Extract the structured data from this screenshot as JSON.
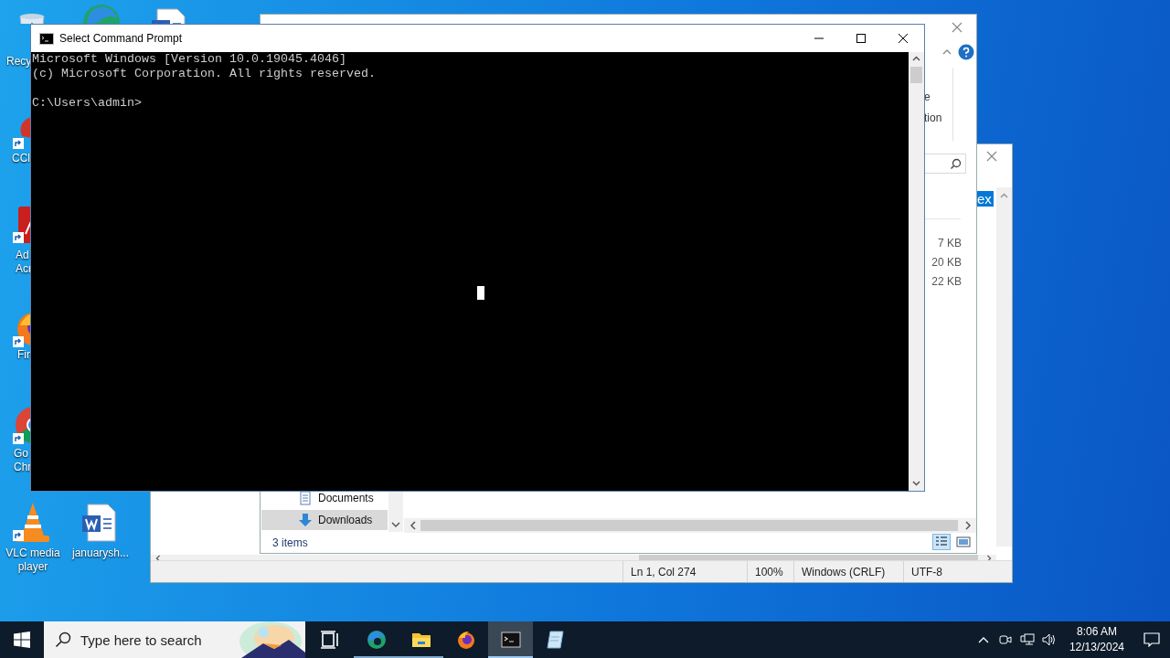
{
  "desktop_icons": [
    {
      "kind": "recycle-bin",
      "label_lines": [
        "Recy"
      ],
      "shortcut": false
    },
    {
      "kind": "edge",
      "shortcut": false
    },
    {
      "kind": "word-doc",
      "shortcut": false
    },
    {
      "kind": "cleaner",
      "label_lines": [
        "CCl"
      ],
      "shortcut": true
    },
    {
      "kind": "acrobat",
      "label_lines": [
        "Ad",
        "Acr"
      ],
      "shortcut": true
    },
    {
      "kind": "firefox",
      "label_lines": [
        "Fir"
      ],
      "shortcut": true
    },
    {
      "kind": "chrome",
      "label_lines": [
        "Go",
        "Chr"
      ],
      "shortcut": true
    },
    {
      "kind": "vlc",
      "label_lines": [
        "VLC media player"
      ],
      "shortcut": true
    },
    {
      "kind": "word-doc",
      "label_lines": [
        "januarysh..."
      ],
      "shortcut": false
    }
  ],
  "notepad": {
    "selected_text": "ex",
    "status": [
      "Ln 1, Col 274",
      "100%",
      "Windows (CRLF)",
      "UTF-8"
    ]
  },
  "explorer": {
    "ribbon_fragments": [
      "e",
      "tion"
    ],
    "sizes": [
      "7 KB",
      "20 KB",
      "22 KB"
    ],
    "nav_items": [
      {
        "kind": "documents",
        "label": "Documents",
        "selected": false
      },
      {
        "kind": "downloads",
        "label": "Downloads",
        "selected": true
      }
    ],
    "status": "3 items",
    "view_buttons": [
      {
        "kind": "details",
        "selected": true
      },
      {
        "kind": "tiles",
        "selected": false
      }
    ]
  },
  "cmd": {
    "title": "Select Command Prompt",
    "lines": [
      "Microsoft Windows [Version 10.0.19045.4046]",
      "(c) Microsoft Corporation. All rights reserved."
    ],
    "prompt": "C:\\Users\\admin>"
  },
  "taskbar": {
    "search_placeholder": "Type here to search",
    "apps": [
      {
        "kind": "task-view",
        "running": false,
        "selected": false
      },
      {
        "kind": "edge",
        "running": true,
        "selected": false
      },
      {
        "kind": "explorer",
        "running": true,
        "selected": false
      },
      {
        "kind": "firefox",
        "running": false,
        "selected": false
      },
      {
        "kind": "cmd",
        "running": true,
        "selected": true
      },
      {
        "kind": "notepad",
        "running": false,
        "selected": false
      }
    ],
    "time": "8:06 AM",
    "date": "12/13/2024"
  }
}
